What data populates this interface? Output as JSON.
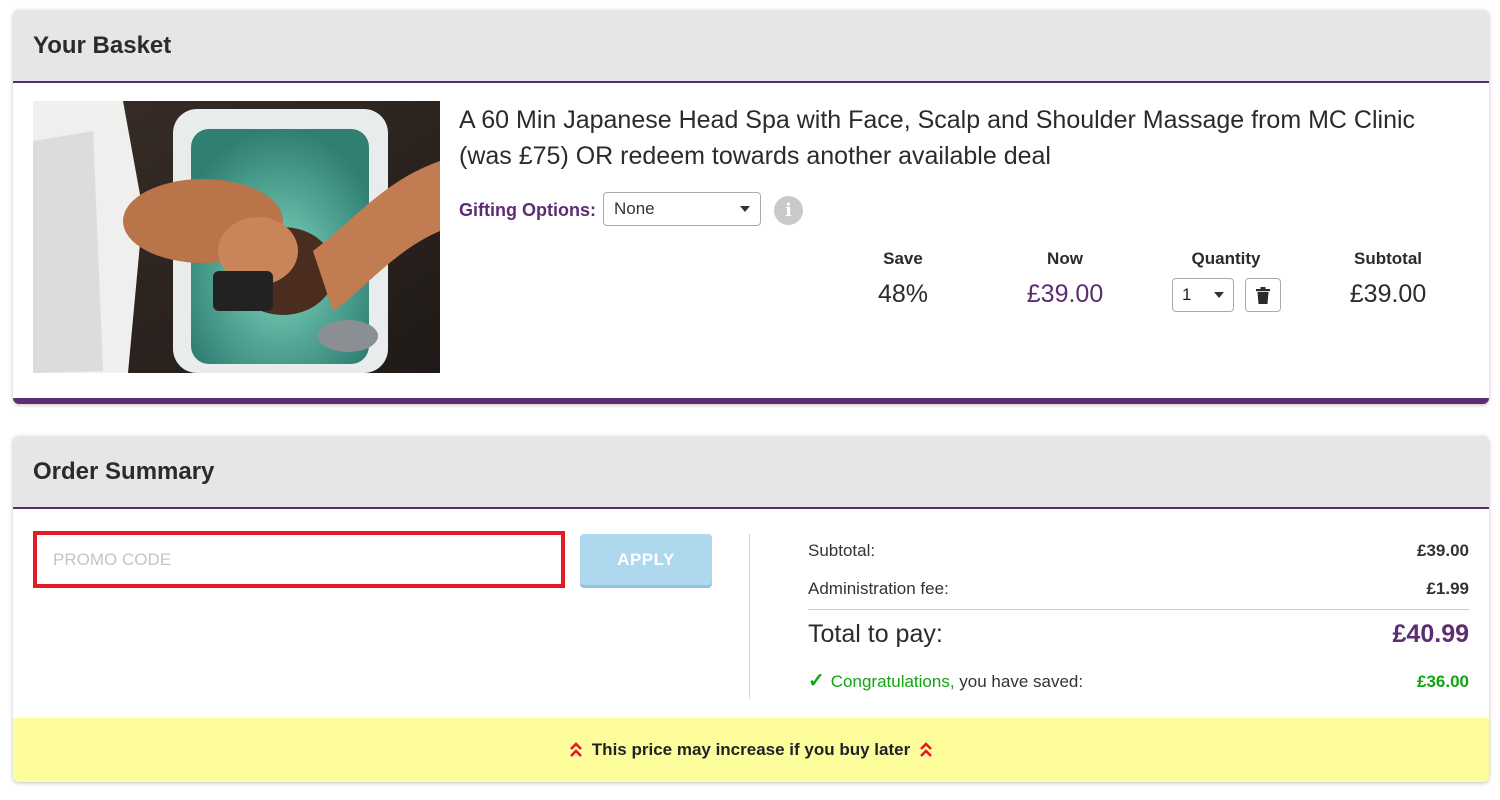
{
  "basket": {
    "heading": "Your Basket",
    "product": {
      "title": "A 60 Min Japanese Head Spa with Face, Scalp and Shoulder Massage from MC Clinic (was £75) OR redeem towards another available deal",
      "image_icon": "photo-icon"
    },
    "gifting": {
      "label": "Gifting Options:",
      "selected": "None"
    },
    "columns": {
      "save": {
        "label": "Save",
        "value": "48%"
      },
      "now": {
        "label": "Now",
        "value": "£39.00"
      },
      "quantity": {
        "label": "Quantity",
        "value": "1"
      },
      "subtotal": {
        "label": "Subtotal",
        "value": "£39.00"
      }
    }
  },
  "summary": {
    "heading": "Order Summary",
    "promo": {
      "placeholder": "PROMO CODE",
      "button": "APPLY"
    },
    "rows": {
      "subtotal": {
        "label": "Subtotal:",
        "value": "£39.00"
      },
      "admin_fee": {
        "label": "Administration fee:",
        "value": "£1.99"
      },
      "total": {
        "label": "Total to pay:",
        "value": "£40.99"
      },
      "saved": {
        "congrats": "Congratulations,",
        "label": " you have saved:",
        "value": "£36.00"
      }
    },
    "warning": "This price may increase if you buy later"
  },
  "colors": {
    "brand_purple": "#5c2d72",
    "highlight_red": "#e01b24",
    "success_green": "#13a313",
    "warning_yellow": "#fdfd9c",
    "apply_blue": "#add8ee"
  }
}
